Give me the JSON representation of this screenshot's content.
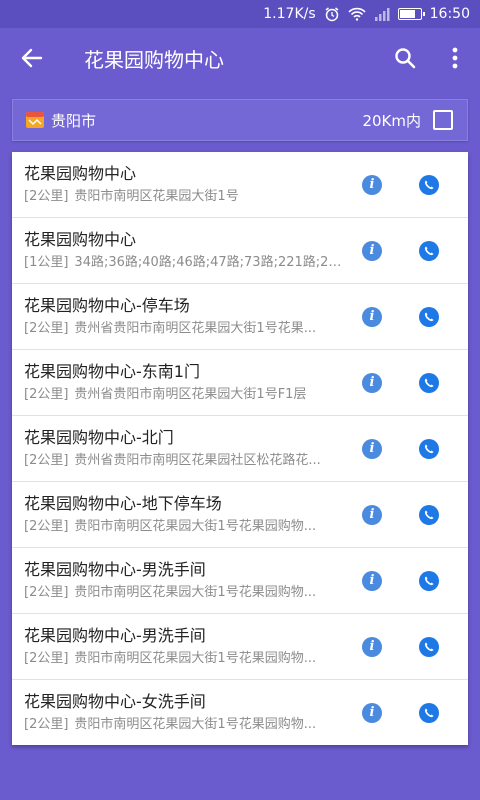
{
  "status_bar": {
    "speed": "1.17K/s",
    "time": "16:50",
    "icons": [
      "alarm-icon",
      "wifi-icon",
      "signal-icon",
      "battery-icon"
    ],
    "battery_level": 0.8
  },
  "app_bar": {
    "title": "花果园购物中心",
    "icons": [
      "back-arrow-icon",
      "search-icon",
      "more-vert-icon"
    ]
  },
  "filter": {
    "city": "贵阳市",
    "range_label": "20Km内",
    "range_checked": false
  },
  "results": [
    {
      "name": "花果园购物中心",
      "distance": "[2公里]",
      "detail": "贵阳市南明区花果园大街1号"
    },
    {
      "name": "花果园购物中心",
      "distance": "[1公里]",
      "detail": "34路;36路;40路;46路;47路;73路;221路;24..."
    },
    {
      "name": "花果园购物中心-停车场",
      "distance": "[2公里]",
      "detail": "贵州省贵阳市南明区花果园大街1号花果..."
    },
    {
      "name": "花果园购物中心-东南1门",
      "distance": "[2公里]",
      "detail": "贵州省贵阳市南明区花果园大街1号F1层"
    },
    {
      "name": "花果园购物中心-北门",
      "distance": "[2公里]",
      "detail": "贵州省贵阳市南明区花果园社区松花路花..."
    },
    {
      "name": "花果园购物中心-地下停车场",
      "distance": "[2公里]",
      "detail": "贵阳市南明区花果园大街1号花果园购物..."
    },
    {
      "name": "花果园购物中心-男洗手间",
      "distance": "[2公里]",
      "detail": "贵阳市南明区花果园大街1号花果园购物..."
    },
    {
      "name": "花果园购物中心-男洗手间",
      "distance": "[2公里]",
      "detail": "贵阳市南明区花果园大街1号花果园购物..."
    },
    {
      "name": "花果园购物中心-女洗手间",
      "distance": "[2公里]",
      "detail": "贵阳市南明区花果园大街1号花果园购物..."
    }
  ],
  "colors": {
    "primary": "#6a5ccf",
    "status_bar": "#5b4fc0",
    "info_icon": "#4a8be0",
    "call_icon": "#1e78e6"
  }
}
